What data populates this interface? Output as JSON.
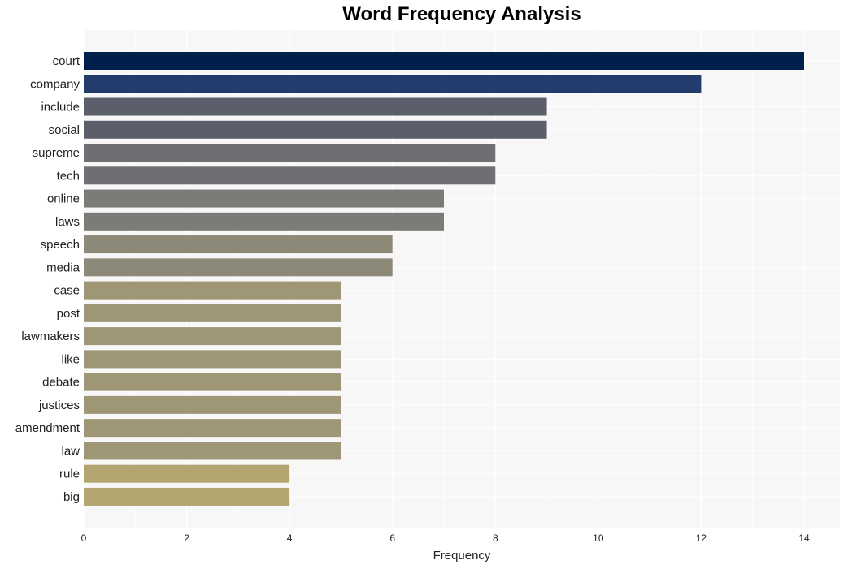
{
  "chart_data": {
    "type": "bar",
    "orientation": "horizontal",
    "title": "Word Frequency Analysis",
    "xlabel": "Frequency",
    "ylabel": "",
    "xlim": [
      0,
      14.7
    ],
    "xticks": [
      0,
      2,
      4,
      6,
      8,
      10,
      12,
      14
    ],
    "grid": true,
    "legend": "none",
    "categories": [
      "court",
      "company",
      "include",
      "social",
      "supreme",
      "tech",
      "online",
      "laws",
      "speech",
      "media",
      "case",
      "post",
      "lawmakers",
      "like",
      "debate",
      "justices",
      "amendment",
      "law",
      "rule",
      "big"
    ],
    "values": [
      14,
      12,
      9,
      9,
      8,
      8,
      7,
      7,
      6,
      6,
      5,
      5,
      5,
      5,
      5,
      5,
      5,
      5,
      4,
      4
    ],
    "colors": [
      "#00204c",
      "#233b6d",
      "#5b5f6c",
      "#5b5f6c",
      "#6e6f72",
      "#6e6f72",
      "#7c7b77",
      "#7c7b77",
      "#8d8978",
      "#8d8978",
      "#9e9675",
      "#9e9675",
      "#9e9675",
      "#9e9675",
      "#9e9675",
      "#9e9675",
      "#9e9675",
      "#9e9675",
      "#b2a570",
      "#b2a570"
    ],
    "background": "#f7f7f7",
    "gridline_color": "#ffffff"
  }
}
